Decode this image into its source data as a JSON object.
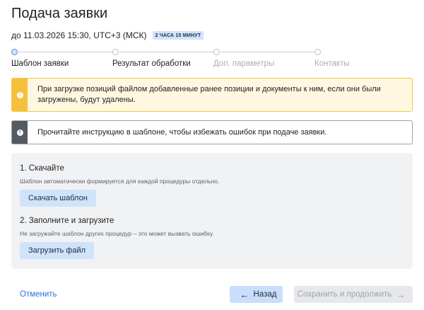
{
  "page": {
    "title": "Подача заявки",
    "deadline_text": "до 11.03.2026 15:30, UTC+3 (МСК)",
    "time_left_badge": "2 ЧАСА 15 МИНУТ"
  },
  "stepper": {
    "steps": [
      {
        "label": "Шаблон заявки",
        "state": "active"
      },
      {
        "label": "Результат обработки",
        "state": "upcoming"
      },
      {
        "label": "Доп. параметры",
        "state": "disabled"
      },
      {
        "label": "Контакты",
        "state": "disabled"
      }
    ]
  },
  "alerts": {
    "warning": {
      "icon": "exclamation-icon",
      "text": "При загрузке позиций файлом добавленные ранее позиции и документы к ним, если они были загружены, будут удалены."
    },
    "info": {
      "icon": "exclamation-icon",
      "text": "Прочитайте инструкцию в шаблоне, чтобы избежать ошибок при подаче заявки."
    }
  },
  "download_section": {
    "title": "1. Скачайте",
    "hint": "Шаблон автоматически формируется для каждой процедуры отдельно.",
    "button_label": "Скачать шаблон"
  },
  "upload_section": {
    "title": "2. Заполните и загрузите",
    "hint": "Не загружайте шаблон других процедур – это может вызвать ошибку.",
    "button_label": "Загрузить файл"
  },
  "footer": {
    "cancel_label": "Отменить",
    "back_label": "Назад",
    "next_label": "Сохранить и продолжить"
  },
  "colors": {
    "accent": "#4a8de3",
    "button_light": "#cfe3fb",
    "warning": "#f5c13d",
    "link": "#2f6fd1"
  }
}
